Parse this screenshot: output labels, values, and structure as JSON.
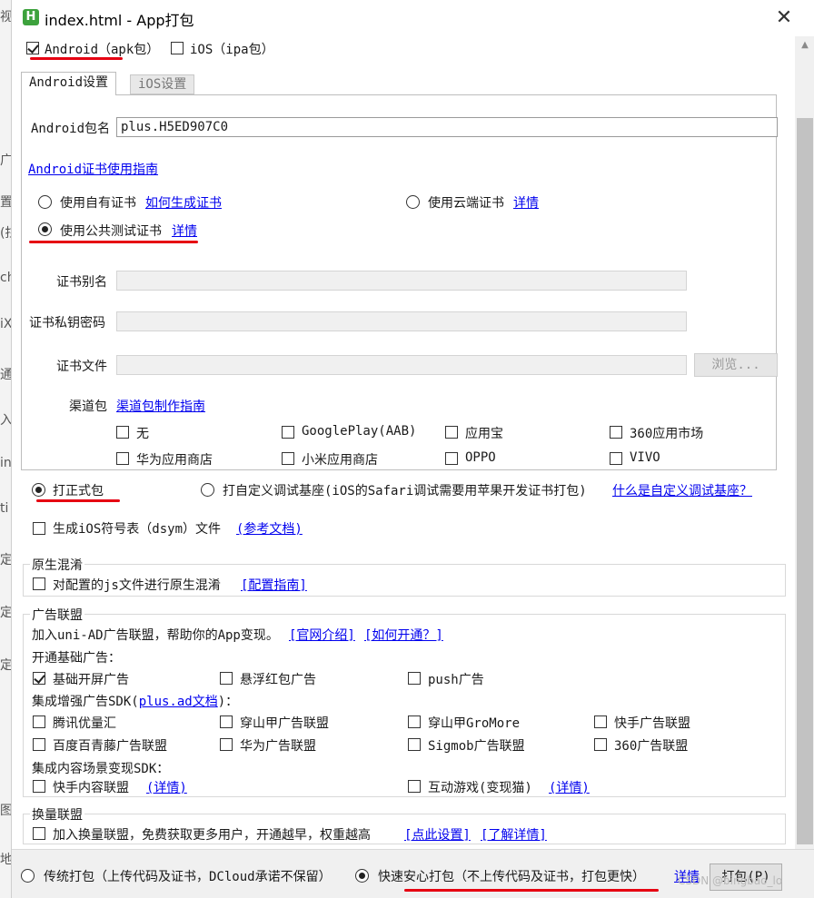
{
  "background": {
    "glyphs": [
      "视",
      "广",
      "置",
      "(拄",
      "ch",
      "iX(",
      "通",
      "入",
      "in",
      "ti",
      "定",
      "定",
      "定",
      "图",
      "地"
    ]
  },
  "window": {
    "title": "index.html - App打包",
    "icon_letter": "H",
    "close_label": "✕"
  },
  "platforms": {
    "android_label": "Android（apk包）",
    "android_checked": true,
    "ios_label": "iOS（ipa包）",
    "ios_checked": false
  },
  "tabs": [
    {
      "label": "Android设置",
      "active": true
    },
    {
      "label": "iOS设置",
      "active": false
    }
  ],
  "android": {
    "package_label": "Android包名",
    "package_value": "plus.H5ED907C0",
    "cert_guide_link": "Android证书使用指南",
    "cert_options": {
      "own_label": "使用自有证书",
      "own_link": "如何生成证书",
      "cloud_label": "使用云端证书",
      "cloud_link": "详情",
      "public_label": "使用公共测试证书",
      "public_link": "详情",
      "selected": "public"
    },
    "alias_label": "证书别名",
    "alias_value": "",
    "password_label": "证书私钥密码",
    "password_value": "",
    "file_label": "证书文件",
    "file_value": "",
    "browse_label": "浏览...",
    "channel_label": "渠道包",
    "channel_link": "渠道包制作指南",
    "channels": [
      {
        "label": "无",
        "checked": false
      },
      {
        "label": "GooglePlay(AAB)",
        "checked": false
      },
      {
        "label": "应用宝",
        "checked": false
      },
      {
        "label": "360应用市场",
        "checked": false
      },
      {
        "label": "华为应用商店",
        "checked": false
      },
      {
        "label": "小米应用商店",
        "checked": false
      },
      {
        "label": "OPPO",
        "checked": false
      },
      {
        "label": "VIVO",
        "checked": false
      }
    ]
  },
  "build_type": {
    "formal_label": "打正式包",
    "custom_label": "打自定义调试基座(iOS的Safari调试需要用苹果开发证书打包)",
    "custom_link": "什么是自定义调试基座？",
    "selected": "formal"
  },
  "dsym": {
    "label": "生成iOS符号表（dsym）文件",
    "link": "(参考文档)",
    "checked": false
  },
  "obfuscation": {
    "title": "原生混淆",
    "label": "对配置的js文件进行原生混淆",
    "link": "[配置指南]",
    "checked": false
  },
  "ads": {
    "title": "广告联盟",
    "intro": "加入uni-AD广告联盟，帮助你的App变现。",
    "intro_link1": "[官网介绍]",
    "intro_link2": "[如何开通？]",
    "basic_title": "开通基础广告：",
    "basic": [
      {
        "label": "基础开屏广告",
        "checked": true
      },
      {
        "label": "悬浮红包广告",
        "checked": false
      },
      {
        "label": "push广告",
        "checked": false
      }
    ],
    "sdk_title_prefix": "集成增强广告SDK(",
    "sdk_title_link": "plus.ad文档",
    "sdk_title_suffix": ")：",
    "sdk": [
      {
        "label": "腾讯优量汇",
        "checked": false
      },
      {
        "label": "穿山甲广告联盟",
        "checked": false
      },
      {
        "label": "穿山甲GroMore",
        "checked": false
      },
      {
        "label": "快手广告联盟",
        "checked": false
      },
      {
        "label": "百度百青藤广告联盟",
        "checked": false
      },
      {
        "label": "华为广告联盟",
        "checked": false
      },
      {
        "label": "Sigmob广告联盟",
        "checked": false
      },
      {
        "label": "360广告联盟",
        "checked": false
      }
    ],
    "content_title": "集成内容场景变现SDK：",
    "content": [
      {
        "label": "快手内容联盟",
        "link": "(详情)",
        "checked": false
      },
      {
        "label": "互动游戏(变现猫)",
        "link": "(详情)",
        "checked": false
      }
    ]
  },
  "exchange": {
    "title": "换量联盟",
    "label": "加入换量联盟，免费获取更多用户，开通越早，权重越高",
    "link1": "[点此设置]",
    "link2": "[了解详情]",
    "checked": false
  },
  "bottom": {
    "traditional_label": "传统打包（上传代码及证书，DCloud承诺不保留）",
    "fast_label": "快速安心打包（不上传代码及证书，打包更快）",
    "details_link": "详情",
    "pack_button": "打包(P)",
    "selected": "fast",
    "watermark": "CSDN @bingbao_lo"
  },
  "colors": {
    "link": "#0000ee",
    "annotation_red": "#e60012",
    "app_icon_green": "#3da23d"
  }
}
